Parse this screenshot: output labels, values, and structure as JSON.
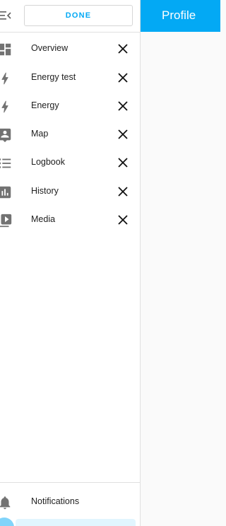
{
  "sidebar": {
    "done_label": "DONE",
    "items": [
      {
        "label": "Overview",
        "icon": "dashboard-icon"
      },
      {
        "label": "Energy test",
        "icon": "lightning-icon"
      },
      {
        "label": "Energy",
        "icon": "lightning-icon"
      },
      {
        "label": "Map",
        "icon": "map-account-icon"
      },
      {
        "label": "Logbook",
        "icon": "format-list-icon"
      },
      {
        "label": "History",
        "icon": "chart-box-icon"
      },
      {
        "label": "Media",
        "icon": "play-box-multiple-icon"
      }
    ],
    "notifications_label": "Notifications"
  },
  "header": {
    "title": "Profile"
  },
  "colors": {
    "accent": "#03a9f4",
    "icon": "#727272",
    "text": "#212121"
  }
}
